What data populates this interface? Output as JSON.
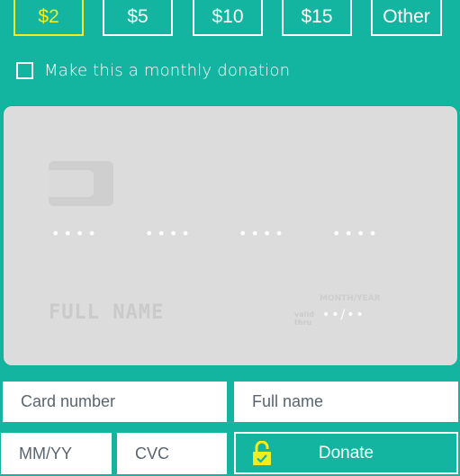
{
  "amounts": [
    {
      "label": "$2",
      "selected": true
    },
    {
      "label": "$5",
      "selected": false
    },
    {
      "label": "$10",
      "selected": false
    },
    {
      "label": "$15",
      "selected": false
    },
    {
      "label": "Other",
      "selected": false
    }
  ],
  "monthly": {
    "label": "Make this a monthly donation",
    "checked": false
  },
  "card_preview": {
    "chip_icon": "card-chip-icon",
    "number_groups": [
      "••••",
      "••••",
      "••••",
      "••••"
    ],
    "name": "FULL NAME",
    "valid_thru": [
      "valid",
      "thru"
    ],
    "expiry_label": "MONTH/YEAR",
    "expiry": "••/••"
  },
  "form": {
    "card_number_placeholder": "Card number",
    "full_name_placeholder": "Full name",
    "expiry_placeholder": "MM/YY",
    "cvc_placeholder": "CVC",
    "donate_label": "Donate",
    "lock_icon": "lock-icon"
  },
  "colors": {
    "background": "#13b5a0",
    "accent": "#f3ec1e",
    "card": "#dcdcdc",
    "border": "#ffffff"
  }
}
